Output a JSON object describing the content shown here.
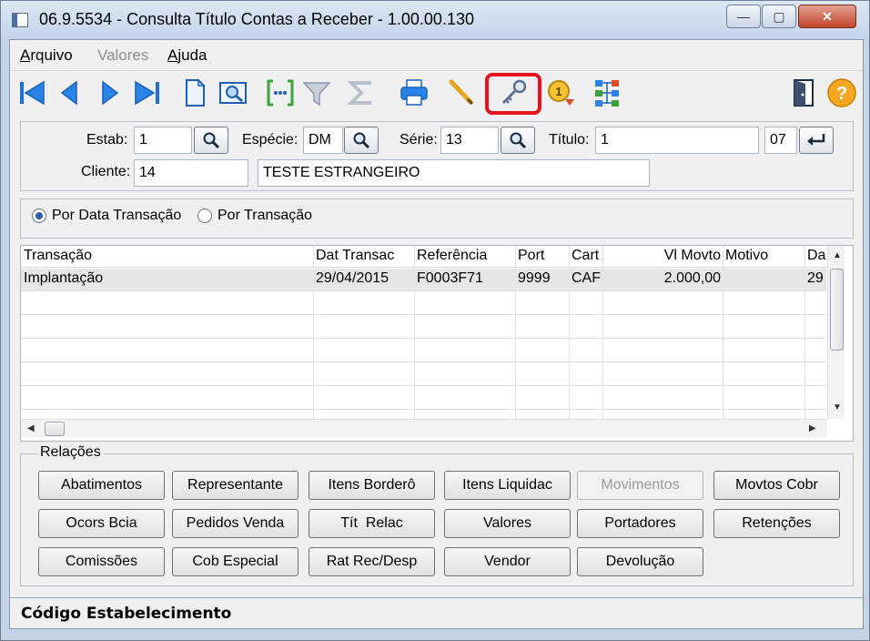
{
  "window": {
    "title": "06.9.5534 - Consulta Título Contas a Receber - 1.00.00.130",
    "minimize_glyph": "—",
    "maximize_glyph": "▢",
    "close_glyph": "✕"
  },
  "menu": {
    "items": [
      {
        "accel": "A",
        "rest": "rquivo",
        "enabled": true
      },
      {
        "accel": "",
        "rest": "Valores",
        "enabled": false
      },
      {
        "accel": "A",
        "rest": "juda",
        "enabled": true
      }
    ]
  },
  "toolbar": {
    "icons": [
      "first-record-icon",
      "previous-record-icon",
      "next-record-icon",
      "last-record-icon",
      "document-icon",
      "preview-icon",
      "goto-icon",
      "filter-icon",
      "sum-icon",
      "print-icon",
      "pencil-icon",
      "key-icon",
      "priority-clock-icon",
      "hierarchy-icon",
      "exit-door-icon",
      "help-icon"
    ],
    "highlighted_icon": "key-icon",
    "highlight_color": "#e8111f"
  },
  "form": {
    "estab_label": "Estab:",
    "estab_value": "1",
    "especie_label": "Espécie:",
    "especie_value": "DM",
    "serie_label": "Série:",
    "serie_value": "13",
    "titulo_label": "Título:",
    "titulo_value": "1",
    "parcela_value": "07",
    "cliente_label": "Cliente:",
    "cliente_value": "14",
    "cliente_name": "TESTE ESTRANGEIRO"
  },
  "radios": {
    "por_data": "Por Data Transação",
    "por_transacao": "Por Transação",
    "selected": "por_data"
  },
  "grid": {
    "columns": [
      "Transação",
      "Dat Transac",
      "Referência",
      "Port",
      "Cart",
      "Vl Movto",
      "Motivo",
      "Da"
    ],
    "rows": [
      [
        "Implantação",
        "29/04/2015",
        "F0003F71",
        "9999",
        "CAF",
        "2.000,00",
        "",
        "29"
      ]
    ]
  },
  "relacoes": {
    "legend": "Relações",
    "buttons": [
      {
        "label": "Abatimentos",
        "enabled": true
      },
      {
        "label": "Representante",
        "enabled": true
      },
      {
        "label": "Itens Borderô",
        "enabled": true
      },
      {
        "label": "Itens Liquidac",
        "enabled": true
      },
      {
        "label": "Movimentos",
        "enabled": false
      },
      {
        "label": "Movtos Cobr",
        "enabled": true
      },
      {
        "label": "Ocors Bcia",
        "enabled": true
      },
      {
        "label": "Pedidos Venda",
        "enabled": true
      },
      {
        "label": "Tít  Relac",
        "enabled": true
      },
      {
        "label": "Valores",
        "enabled": true
      },
      {
        "label": "Portadores",
        "enabled": true
      },
      {
        "label": "Retenções",
        "enabled": true
      },
      {
        "label": "Comissões",
        "enabled": true
      },
      {
        "label": "Cob Especial",
        "enabled": true
      },
      {
        "label": "Rat Rec/Desp",
        "enabled": true
      },
      {
        "label": "Vendor",
        "enabled": true
      },
      {
        "label": "Devolução",
        "enabled": true
      }
    ]
  },
  "status": {
    "text": "Código Estabelecimento"
  }
}
